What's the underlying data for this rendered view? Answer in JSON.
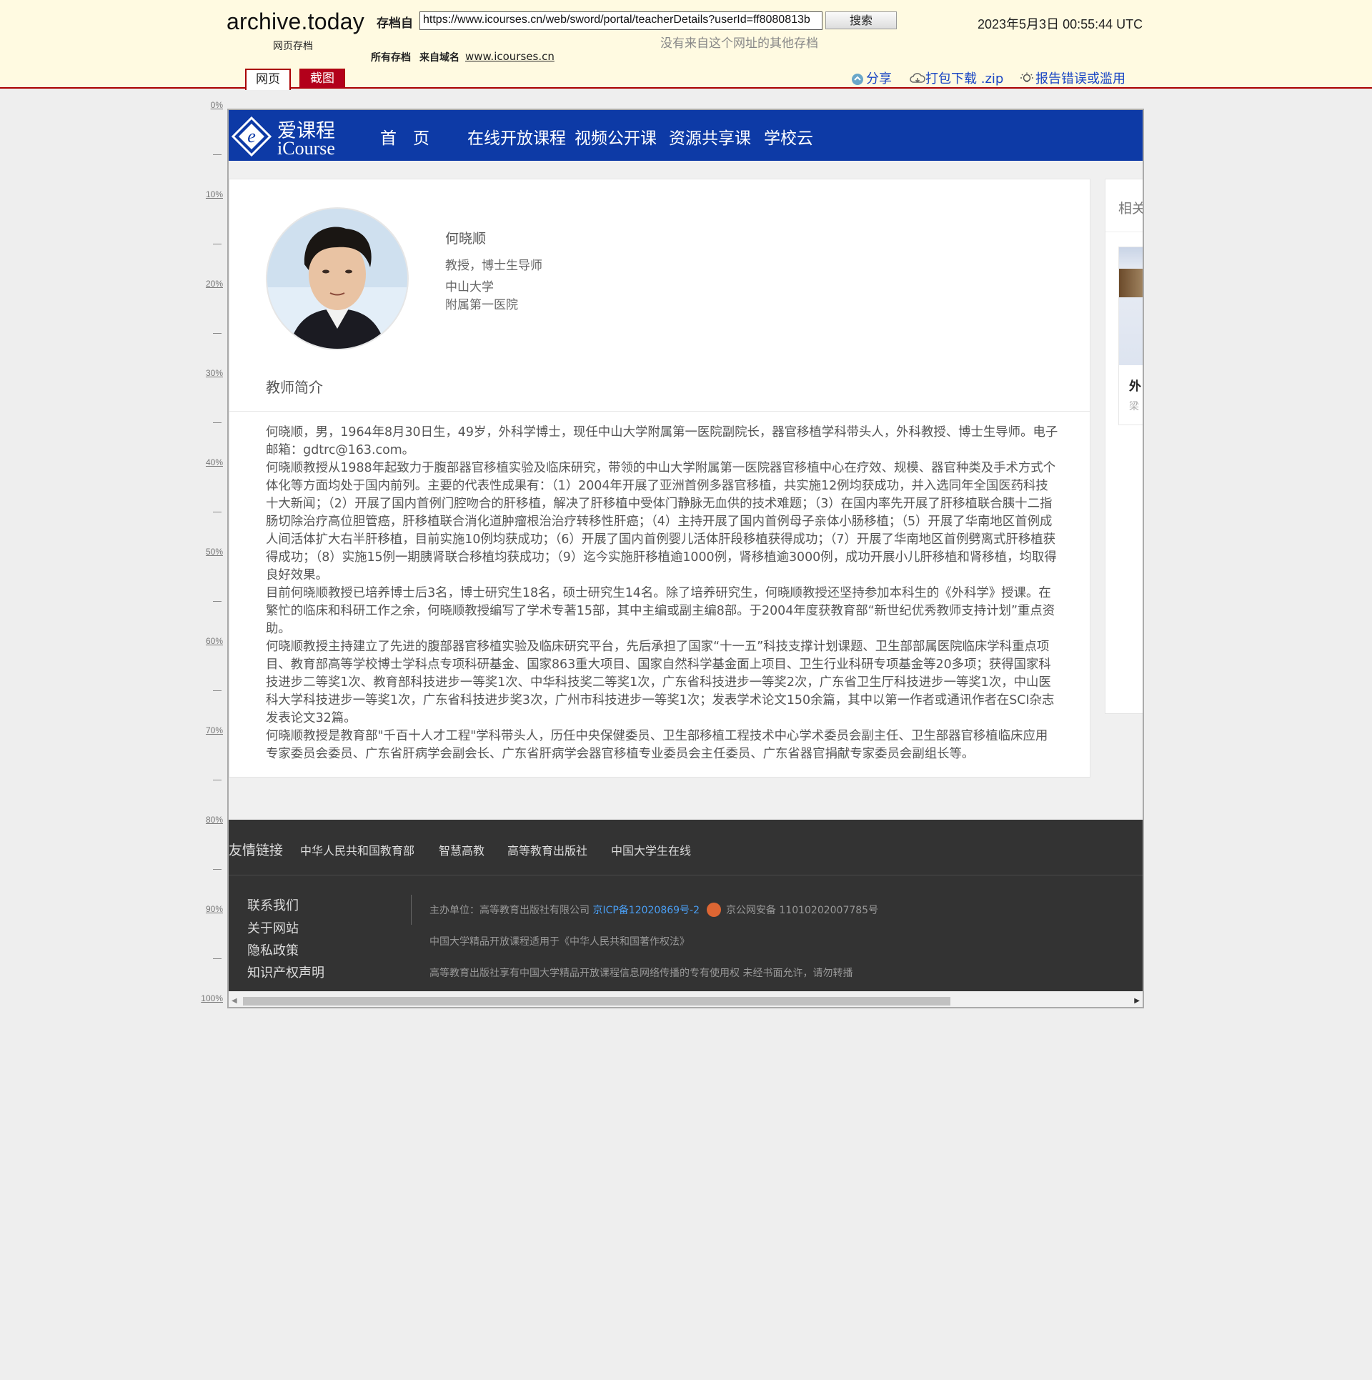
{
  "archive": {
    "logo": "archive.today",
    "logo_sub": "网页存档",
    "saved_from_label": "存档自",
    "url_value": "https://www.icourses.cn/web/sword/portal/teacherDetails?userId=ff8080813b",
    "search_label": "搜索",
    "no_other": "没有来自这个网址的其他存档",
    "all_snapshots": "所有存档",
    "from_domain_label": "来自域名",
    "domain": "www.icourses.cn",
    "timestamp": "2023年5月3日 00:55:44 UTC",
    "tabs": [
      "网页",
      "截图"
    ],
    "actions": {
      "share": "分享",
      "zip": "打包下载 .zip",
      "report": "报告错误或滥用"
    }
  },
  "ruler": {
    "labels": [
      "0%",
      "10%",
      "20%",
      "30%",
      "40%",
      "50%",
      "60%",
      "70%",
      "80%",
      "90%",
      "100%"
    ]
  },
  "site": {
    "logo_cn": "爱课程",
    "logo_en": "iCourse",
    "nav": [
      "首　页",
      "在线开放课程",
      "视频公开课",
      "资源共享课",
      "学校云"
    ],
    "brand_color": "#0d3aa6"
  },
  "teacher": {
    "name": "何晓顺",
    "title": "教授，博士生导师",
    "school": "中山大学",
    "dept": "附属第一医院",
    "intro_heading": "教师简介",
    "intro": [
      "何晓顺，男，1964年8月30日生，49岁，外科学博士，现任中山大学附属第一医院副院长，器官移植学科带头人，外科教授、博士生导师。电子邮箱：gdtrc@163.com。",
      "何晓顺教授从1988年起致力于腹部器官移植实验及临床研究，带领的中山大学附属第一医院器官移植中心在疗效、规模、器官种类及手术方式个体化等方面均处于国内前列。主要的代表性成果有：（1）2004年开展了亚洲首例多器官移植，共实施12例均获成功，并入选同年全国医药科技十大新闻；（2）开展了国内首例门腔吻合的肝移植，解决了肝移植中受体门静脉无血供的技术难题；（3）在国内率先开展了肝移植联合胰十二指肠切除治疗高位胆管癌，肝移植联合消化道肿瘤根治治疗转移性肝癌；（4）主持开展了国内首例母子亲体小肠移植；（5）开展了华南地区首例成人间活体扩大右半肝移植，目前实施10例均获成功；（6）开展了国内首例婴儿活体肝段移植获得成功；（7）开展了华南地区首例劈离式肝移植获得成功；（8）实施15例一期胰肾联合移植均获成功；（9）迄今实施肝移植逾1000例，肾移植逾3000例，成功开展小儿肝移植和肾移植，均取得良好效果。",
      "目前何晓顺教授已培养博士后3名，博士研究生18名，硕士研究生14名。除了培养研究生，何晓顺教授还坚持参加本科生的《外科学》授课。在繁忙的临床和科研工作之余，何晓顺教授编写了学术专著15部，其中主编或副主编8部。于2004年度获教育部“新世纪优秀教师支持计划”重点资助。",
      "何晓顺教授主持建立了先进的腹部器官移植实验及临床研究平台，先后承担了国家“十一五”科技支撑计划课题、卫生部部属医院临床学科重点项目、教育部高等学校博士学科点专项科研基金、国家863重大项目、国家自然科学基金面上项目、卫生行业科研专项基金等20多项；获得国家科技进步二等奖1次、教育部科技进步一等奖1次、中华科技奖二等奖1次，广东省科技进步一等奖2次，广东省卫生厅科技进步一等奖1次，中山医科大学科技进步一等奖1次，广东省科技进步奖3次，广州市科技进步一等奖1次；发表学术论文150余篇，其中以第一作者或通讯作者在SCI杂志发表论文32篇。",
      "何晓顺教授是教育部\"千百十人才工程\"学科带头人，历任中央保健委员、卫生部移植工程技术中心学术委员会副主任、卫生部器官移植临床应用专家委员会委员、广东省肝病学会副会长、广东省肝病学会器官移植专业委员会主任委员、广东省器官捐献专家委员会副组长等。"
    ]
  },
  "sidebar": {
    "title": "相关",
    "item_title": "外",
    "item_sub": "梁"
  },
  "footer": {
    "links_label": "友情链接",
    "links": [
      "中华人民共和国教育部",
      "智慧高教",
      "高等教育出版社",
      "中国大学生在线"
    ],
    "nav": [
      "联系我们",
      "关于网站",
      "隐私政策",
      "知识产权声明"
    ],
    "host": "主办单位：高等教育出版社有限公司",
    "icp": "京ICP备12020869号-2",
    "police": "京公网安备 11010202007785号",
    "copyright_note": "中国大学精品开放课程适用于《中华人民共和国著作权法》",
    "rights_note": "高等教育出版社享有中国大学精品开放课程信息网络传播的专有使用权 未经书面允许，请勿转播"
  }
}
